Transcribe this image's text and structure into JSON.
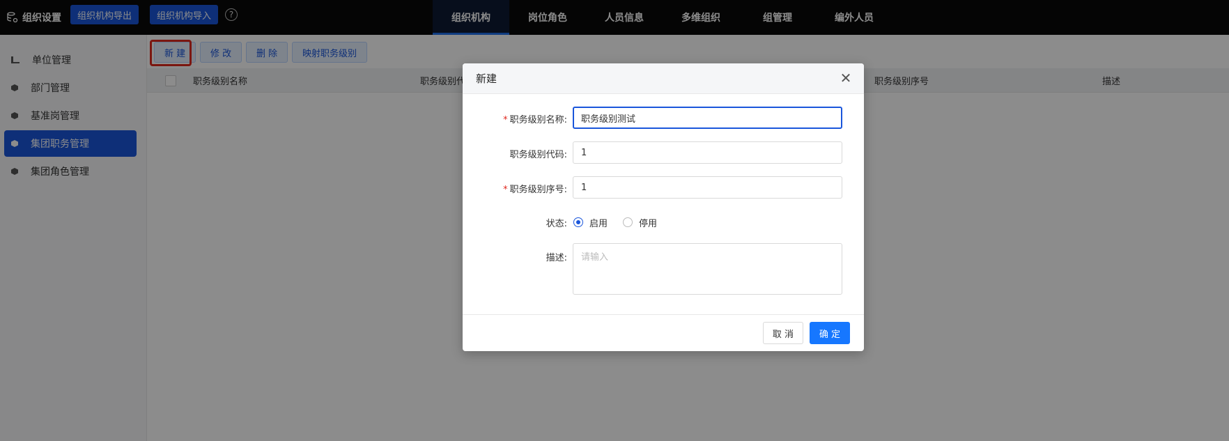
{
  "header": {
    "brand": "组织设置",
    "buttons": [
      "组织机构导出",
      "组织机构导入"
    ],
    "help": "?",
    "nav": [
      "组织机构",
      "岗位角色",
      "人员信息",
      "多维组织",
      "组管理",
      "编外人员"
    ],
    "active_nav": "组织机构"
  },
  "sidebar": {
    "items": [
      {
        "label": "单位管理"
      },
      {
        "label": "部门管理"
      },
      {
        "label": "基准岗管理"
      },
      {
        "label": "集团职务管理"
      },
      {
        "label": "集团角色管理"
      }
    ],
    "active": "集团职务管理"
  },
  "toolbar": {
    "new": "新 建",
    "edit": "修 改",
    "delete": "删 除",
    "map": "映射职务级别"
  },
  "table": {
    "columns": [
      "职务级别名称",
      "职务级别代码",
      "职务级别序号",
      "描述"
    ]
  },
  "modal": {
    "title": "新建",
    "close": "✕",
    "fields": {
      "name": {
        "label": "职务级别名称:",
        "value": "职务级别测试",
        "required": true
      },
      "code": {
        "label": "职务级别代码:",
        "value": "1",
        "required": false
      },
      "order": {
        "label": "职务级别序号:",
        "value": "1",
        "required": true
      },
      "status": {
        "label": "状态:",
        "options": [
          "启用",
          "停用"
        ],
        "selected": "启用"
      },
      "desc": {
        "label": "描述:",
        "placeholder": "请输入"
      }
    },
    "cancel": "取 消",
    "ok": "确 定"
  },
  "colors": {
    "accent": "#1a56db",
    "primary_button": "#1677ff",
    "topbar": "#0a0a0a",
    "required": "#e0281e"
  }
}
